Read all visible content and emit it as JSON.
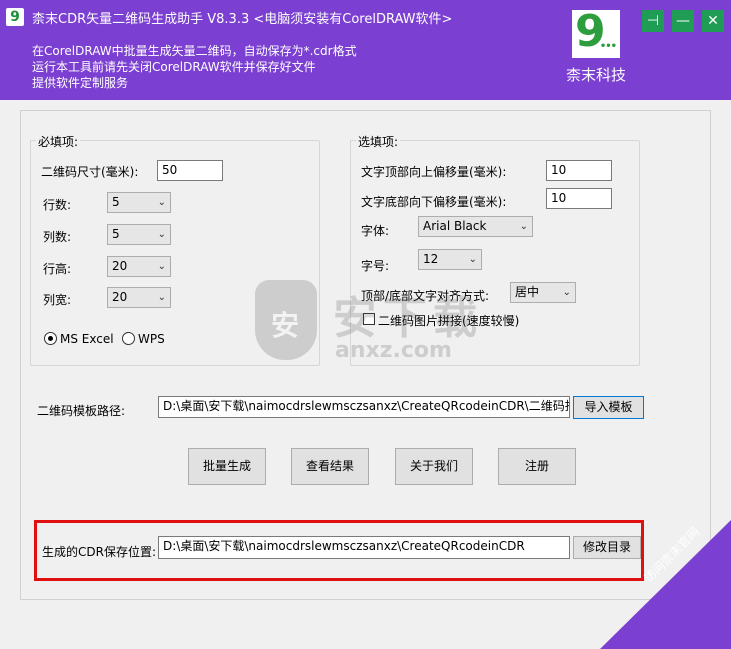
{
  "window": {
    "app_icon_glyph": "9",
    "title": "柰末CDR矢量二维码生成助手 V8.3.3   <电脑须安装有CorelDRAW软件>",
    "pin_glyph": "⊣",
    "minimize_glyph": "—",
    "close_glyph": "✕"
  },
  "header": {
    "line1": "在CorelDRAW中批量生成矢量二维码，自动保存为*.cdr格式",
    "line2": "运行本工具前请先关闭CorelDRAW软件并保存好文件",
    "line3": "提供软件定制服务",
    "logo_number": "9",
    "logo_dots": "•••",
    "company": "柰末科技"
  },
  "required": {
    "title": "必填项:",
    "qr_size_label": "二维码尺寸(毫米):",
    "qr_size_value": "50",
    "rows_label": "行数:",
    "rows_value": "5",
    "cols_label": "列数:",
    "cols_value": "5",
    "row_height_label": "行高:",
    "row_height_value": "20",
    "col_width_label": "列宽:",
    "col_width_value": "20",
    "excel_label": "MS Excel",
    "wps_label": "WPS"
  },
  "optional": {
    "title": "选填项:",
    "top_offset_label": "文字顶部向上偏移量(毫米):",
    "top_offset_value": "10",
    "bottom_offset_label": "文字底部向下偏移量(毫米):",
    "bottom_offset_value": "10",
    "font_label": "字体:",
    "font_value": "Arial Black",
    "size_label": "字号:",
    "size_value": "12",
    "align_label": "顶部/底部文字对齐方式:",
    "align_value": "居中",
    "concat_label": "二维码图片拼接(速度较慢)"
  },
  "template": {
    "label": "二维码模板路径:",
    "path": "D:\\桌面\\安下载\\naimocdrslewmsczsanxz\\CreateQRcodeinCDR\\二维码批量生",
    "import_button": "导入模板"
  },
  "actions": {
    "batch": "批量生成",
    "view": "查看结果",
    "about": "关于我们",
    "register": "注册"
  },
  "output": {
    "label": "生成的CDR保存位置:",
    "path": "D:\\桌面\\安下载\\naimocdrslewmsczsanxz\\CreateQRcodeinCDR",
    "change_button": "修改目录"
  },
  "watermark": {
    "shield_glyph": "安",
    "cn": "安下载",
    "en": "anxz.com"
  },
  "ribbon": {
    "text": "访问柰末官网"
  },
  "icons": {
    "chevron": "⌄"
  },
  "colors": {
    "header": "#7b3fd1",
    "win_buttons": "#1f9d55",
    "highlight": "#e01010"
  }
}
